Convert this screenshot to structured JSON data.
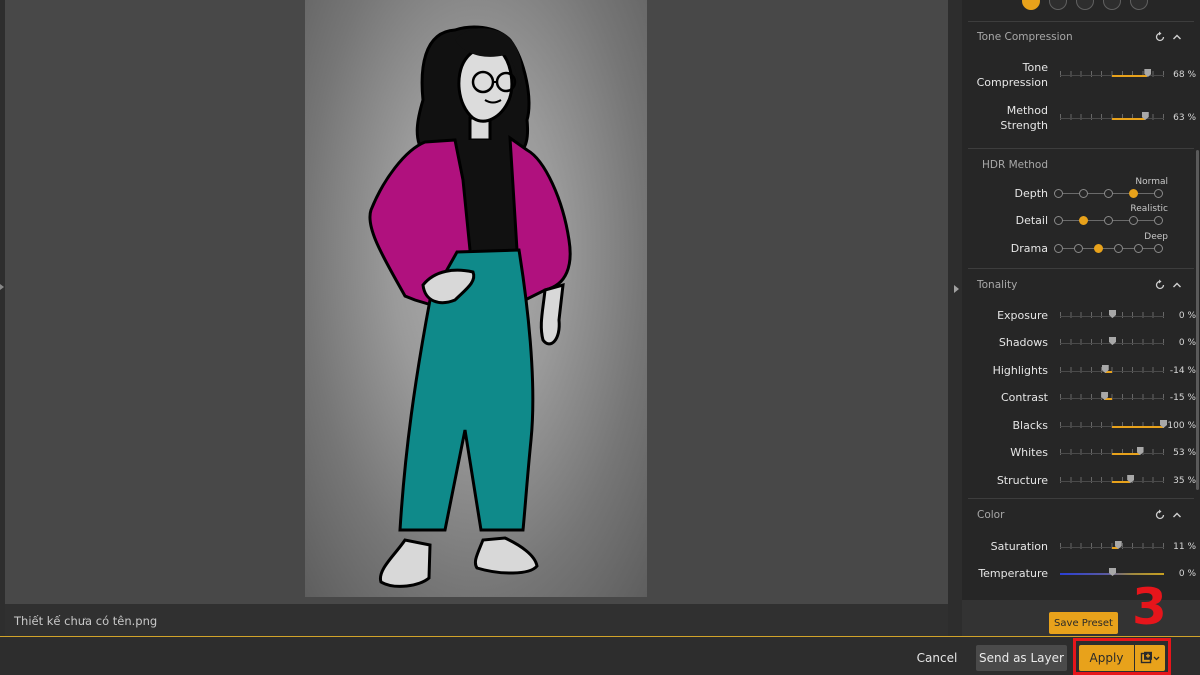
{
  "file": {
    "name": "Thiết kế chưa có tên.png"
  },
  "colors": {
    "accent": "#e8a21b",
    "annotation": "#e6151b",
    "panel": "#262626"
  },
  "sections": {
    "tone_compression": {
      "title": "Tone Compression",
      "rows": [
        {
          "label": "Tone\nCompression",
          "value": "68 %",
          "level": 68
        },
        {
          "label": "Method\nStrength",
          "value": "63 %",
          "level": 63
        }
      ]
    },
    "hdr_method": {
      "title": "HDR Method",
      "rows": [
        {
          "label": "Depth",
          "step_name": "Normal",
          "steps": 5,
          "selected": 3
        },
        {
          "label": "Detail",
          "step_name": "Realistic",
          "steps": 5,
          "selected": 1
        },
        {
          "label": "Drama",
          "step_name": "Deep",
          "steps": 6,
          "selected": 2
        }
      ]
    },
    "tonality": {
      "title": "Tonality",
      "rows": [
        {
          "label": "Exposure",
          "value": "0 %",
          "level": 0
        },
        {
          "label": "Shadows",
          "value": "0 %",
          "level": 0
        },
        {
          "label": "Highlights",
          "value": "-14 %",
          "level": -14
        },
        {
          "label": "Contrast",
          "value": "-15 %",
          "level": -15
        },
        {
          "label": "Blacks",
          "value": "100 %",
          "level": 100
        },
        {
          "label": "Whites",
          "value": "53 %",
          "level": 53
        },
        {
          "label": "Structure",
          "value": "35 %",
          "level": 35
        }
      ]
    },
    "color": {
      "title": "Color",
      "rows": [
        {
          "label": "Saturation",
          "value": "11 %",
          "level": 11
        },
        {
          "label": "Temperature",
          "value": "0 %",
          "level": 0
        }
      ]
    }
  },
  "buttons": {
    "save_preset": "Save Preset",
    "cancel": "Cancel",
    "send_as_layer": "Send as Layer",
    "apply": "Apply"
  },
  "annotation": {
    "step": "3"
  },
  "icons": {
    "reset": "reset-icon",
    "collapse": "chevron-up-icon",
    "apply_options": "layer-add-icon"
  }
}
